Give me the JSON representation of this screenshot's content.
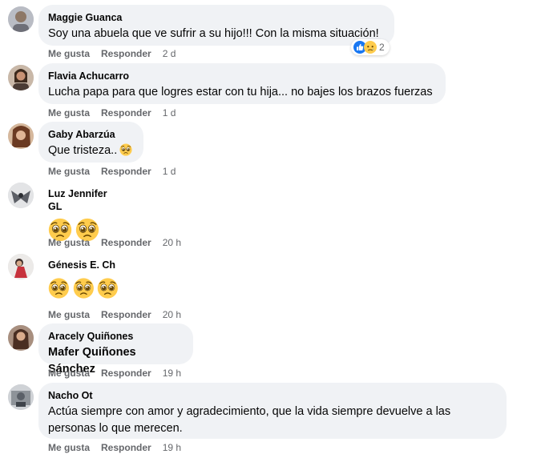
{
  "actions": {
    "like": "Me gusta",
    "reply": "Responder"
  },
  "comments": [
    {
      "author": "Maggie Guanca",
      "text": "Soy una abuela que ve sufrir a su hijo!!! Con la misma situación!",
      "time": "2 d",
      "reactions": {
        "types": [
          "like-icon",
          "sad-icon"
        ],
        "count": "2"
      }
    },
    {
      "author": "Flavia Achucarro",
      "text": "Lucha papa para que logres estar con tu hija... no bajes los brazos fuerzas",
      "time": "1 d"
    },
    {
      "author": "Gaby Abarzúa",
      "text": "Que tristeza..",
      "time": "1 d",
      "emoji": "pleading-face-icon"
    },
    {
      "author": "Luz Jennifer GL",
      "time": "20 h",
      "emoji_count": 2
    },
    {
      "author": "Génesis E. Ch",
      "time": "20 h",
      "emoji_count": 3
    },
    {
      "author": "Aracely Quiñones",
      "text": "Mafer Quiñones Sánchez",
      "time": "19 h"
    },
    {
      "author": "Nacho Ot",
      "text_line1": "Actúa siempre con amor y agradecimiento, que la vida siempre devuelve a las",
      "text_line2": "personas lo que merecen.",
      "time": "19 h"
    }
  ],
  "colors": {
    "bubble": "#f0f2f5",
    "secondary_text": "#65676b",
    "like_blue": "#1877f2",
    "emoji_yellow": "#ffcc4d"
  }
}
